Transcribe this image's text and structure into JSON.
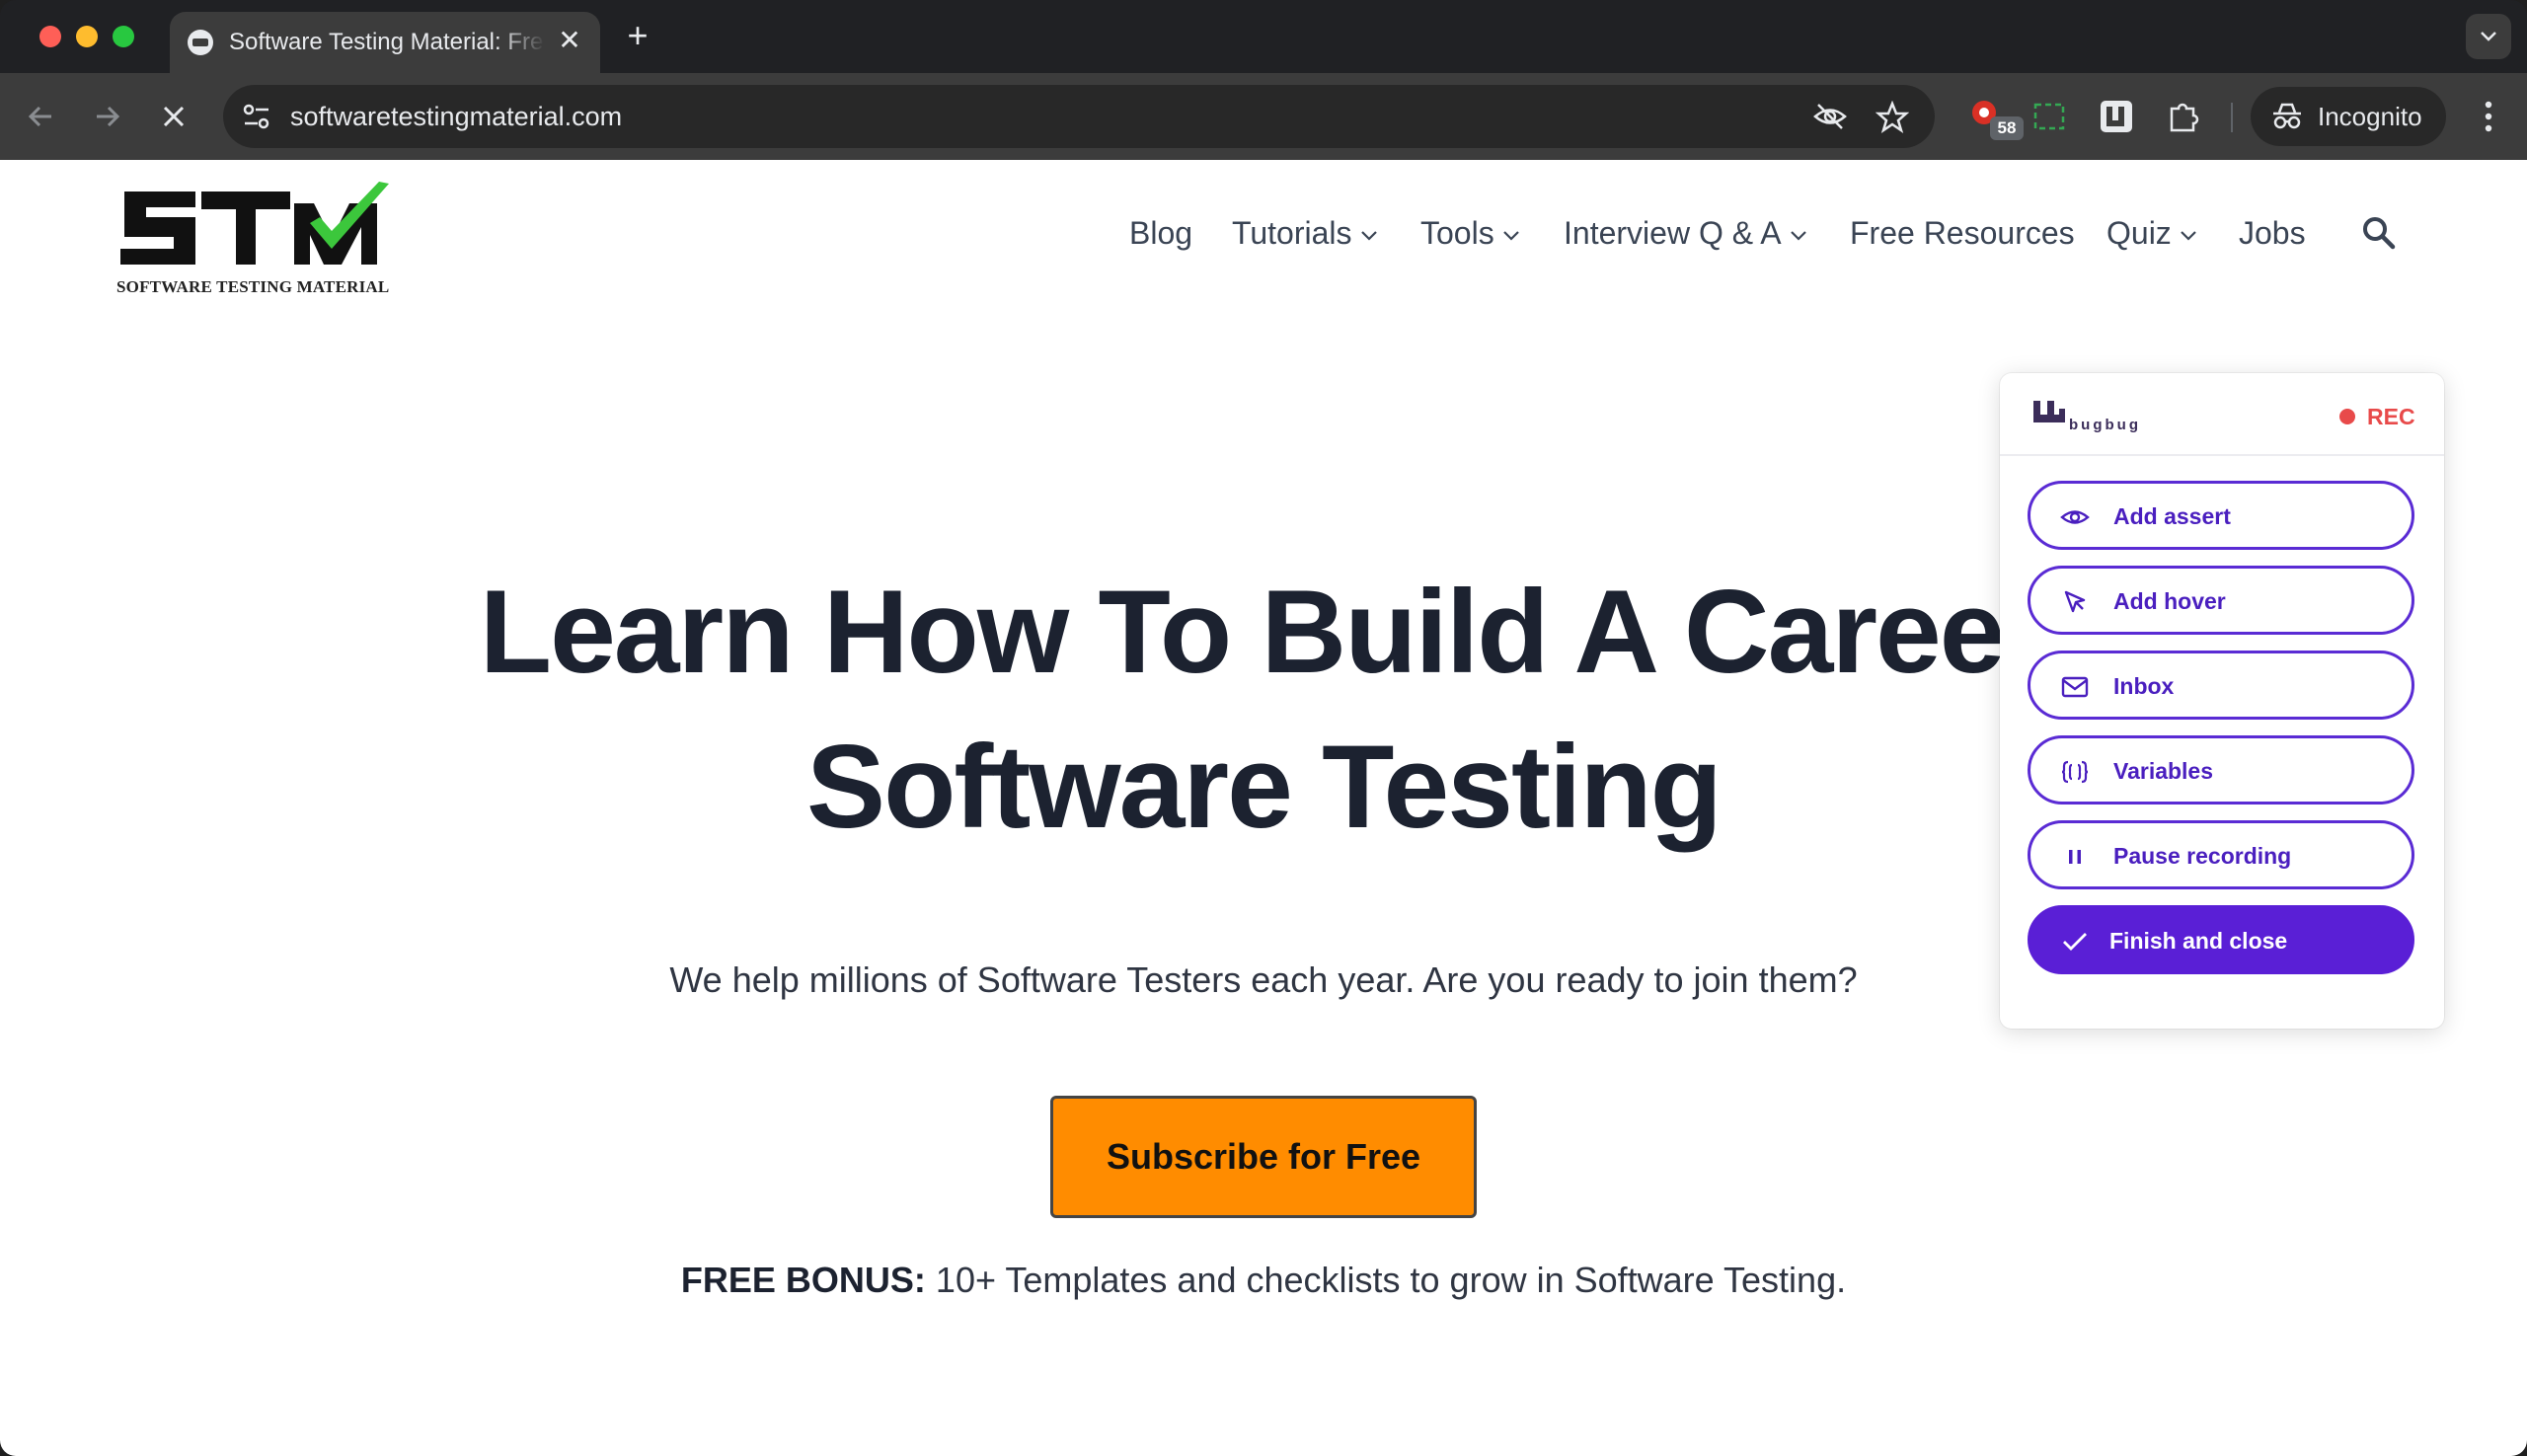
{
  "browser": {
    "tab_title": "Software Testing Material: Free",
    "url": "softwaretestingmaterial.com",
    "extension_badge": "58",
    "incognito_label": "Incognito"
  },
  "site": {
    "logo_text": "STM",
    "logo_tagline": "SOFTWARE TESTING MATERIAL",
    "nav": [
      {
        "label": "Blog"
      },
      {
        "label": "Tutorials"
      },
      {
        "label": "Tools"
      },
      {
        "label": "Interview Q & A"
      },
      {
        "label": "Free Resources"
      },
      {
        "label": "Quiz"
      },
      {
        "label": "Jobs"
      }
    ],
    "hero_title_line1": "Learn How To Build A Career",
    "hero_title_line2": "Software Testing",
    "hero_subtitle": "We help millions of Software Testers each year. Are you ready to join them?",
    "cta_label": "Subscribe for Free",
    "bonus_bold": "FREE BONUS:",
    "bonus_text": " 10+ Templates and checklists to grow in Software Testing."
  },
  "bugbug": {
    "brand": "bugbug",
    "rec_label": "REC",
    "buttons": [
      {
        "label": "Add assert",
        "icon": "eye-icon"
      },
      {
        "label": "Add hover",
        "icon": "cursor-icon"
      },
      {
        "label": "Inbox",
        "icon": "mail-icon"
      },
      {
        "label": "Variables",
        "icon": "braces-icon"
      },
      {
        "label": "Pause recording",
        "icon": "pause-icon"
      },
      {
        "label": "Finish and close",
        "icon": "check-icon"
      }
    ],
    "colors": {
      "accent": "#5a1fd6",
      "rec": "#e84a4a"
    }
  },
  "colors": {
    "cta": "#ff8c00",
    "logo_green": "#3cc73c"
  }
}
